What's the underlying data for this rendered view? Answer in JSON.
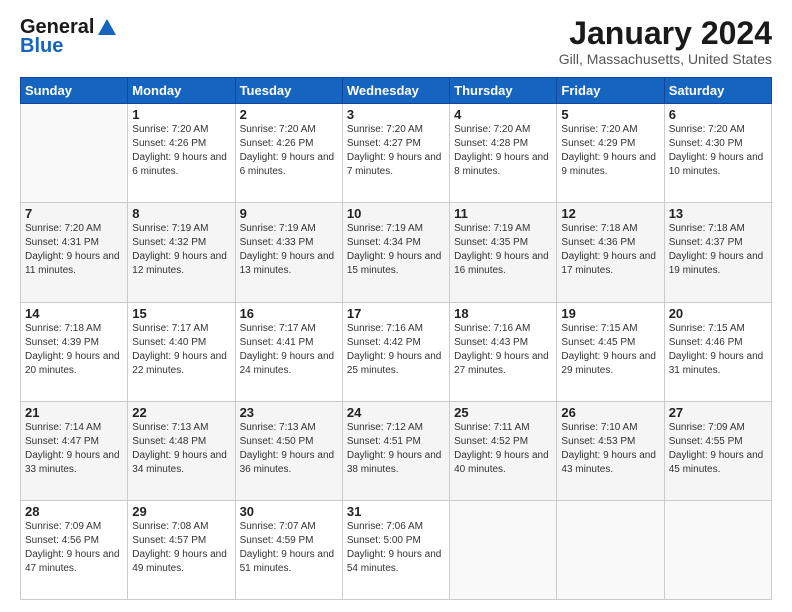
{
  "header": {
    "logo_line1": "General",
    "logo_line2": "Blue",
    "title": "January 2024",
    "subtitle": "Gill, Massachusetts, United States"
  },
  "weekdays": [
    "Sunday",
    "Monday",
    "Tuesday",
    "Wednesday",
    "Thursday",
    "Friday",
    "Saturday"
  ],
  "weeks": [
    [
      {
        "num": "",
        "sunrise": "",
        "sunset": "",
        "daylight": "",
        "empty": true
      },
      {
        "num": "1",
        "sunrise": "Sunrise: 7:20 AM",
        "sunset": "Sunset: 4:26 PM",
        "daylight": "Daylight: 9 hours and 6 minutes."
      },
      {
        "num": "2",
        "sunrise": "Sunrise: 7:20 AM",
        "sunset": "Sunset: 4:26 PM",
        "daylight": "Daylight: 9 hours and 6 minutes."
      },
      {
        "num": "3",
        "sunrise": "Sunrise: 7:20 AM",
        "sunset": "Sunset: 4:27 PM",
        "daylight": "Daylight: 9 hours and 7 minutes."
      },
      {
        "num": "4",
        "sunrise": "Sunrise: 7:20 AM",
        "sunset": "Sunset: 4:28 PM",
        "daylight": "Daylight: 9 hours and 8 minutes."
      },
      {
        "num": "5",
        "sunrise": "Sunrise: 7:20 AM",
        "sunset": "Sunset: 4:29 PM",
        "daylight": "Daylight: 9 hours and 9 minutes."
      },
      {
        "num": "6",
        "sunrise": "Sunrise: 7:20 AM",
        "sunset": "Sunset: 4:30 PM",
        "daylight": "Daylight: 9 hours and 10 minutes."
      }
    ],
    [
      {
        "num": "7",
        "sunrise": "Sunrise: 7:20 AM",
        "sunset": "Sunset: 4:31 PM",
        "daylight": "Daylight: 9 hours and 11 minutes."
      },
      {
        "num": "8",
        "sunrise": "Sunrise: 7:19 AM",
        "sunset": "Sunset: 4:32 PM",
        "daylight": "Daylight: 9 hours and 12 minutes."
      },
      {
        "num": "9",
        "sunrise": "Sunrise: 7:19 AM",
        "sunset": "Sunset: 4:33 PM",
        "daylight": "Daylight: 9 hours and 13 minutes."
      },
      {
        "num": "10",
        "sunrise": "Sunrise: 7:19 AM",
        "sunset": "Sunset: 4:34 PM",
        "daylight": "Daylight: 9 hours and 15 minutes."
      },
      {
        "num": "11",
        "sunrise": "Sunrise: 7:19 AM",
        "sunset": "Sunset: 4:35 PM",
        "daylight": "Daylight: 9 hours and 16 minutes."
      },
      {
        "num": "12",
        "sunrise": "Sunrise: 7:18 AM",
        "sunset": "Sunset: 4:36 PM",
        "daylight": "Daylight: 9 hours and 17 minutes."
      },
      {
        "num": "13",
        "sunrise": "Sunrise: 7:18 AM",
        "sunset": "Sunset: 4:37 PM",
        "daylight": "Daylight: 9 hours and 19 minutes."
      }
    ],
    [
      {
        "num": "14",
        "sunrise": "Sunrise: 7:18 AM",
        "sunset": "Sunset: 4:39 PM",
        "daylight": "Daylight: 9 hours and 20 minutes."
      },
      {
        "num": "15",
        "sunrise": "Sunrise: 7:17 AM",
        "sunset": "Sunset: 4:40 PM",
        "daylight": "Daylight: 9 hours and 22 minutes."
      },
      {
        "num": "16",
        "sunrise": "Sunrise: 7:17 AM",
        "sunset": "Sunset: 4:41 PM",
        "daylight": "Daylight: 9 hours and 24 minutes."
      },
      {
        "num": "17",
        "sunrise": "Sunrise: 7:16 AM",
        "sunset": "Sunset: 4:42 PM",
        "daylight": "Daylight: 9 hours and 25 minutes."
      },
      {
        "num": "18",
        "sunrise": "Sunrise: 7:16 AM",
        "sunset": "Sunset: 4:43 PM",
        "daylight": "Daylight: 9 hours and 27 minutes."
      },
      {
        "num": "19",
        "sunrise": "Sunrise: 7:15 AM",
        "sunset": "Sunset: 4:45 PM",
        "daylight": "Daylight: 9 hours and 29 minutes."
      },
      {
        "num": "20",
        "sunrise": "Sunrise: 7:15 AM",
        "sunset": "Sunset: 4:46 PM",
        "daylight": "Daylight: 9 hours and 31 minutes."
      }
    ],
    [
      {
        "num": "21",
        "sunrise": "Sunrise: 7:14 AM",
        "sunset": "Sunset: 4:47 PM",
        "daylight": "Daylight: 9 hours and 33 minutes."
      },
      {
        "num": "22",
        "sunrise": "Sunrise: 7:13 AM",
        "sunset": "Sunset: 4:48 PM",
        "daylight": "Daylight: 9 hours and 34 minutes."
      },
      {
        "num": "23",
        "sunrise": "Sunrise: 7:13 AM",
        "sunset": "Sunset: 4:50 PM",
        "daylight": "Daylight: 9 hours and 36 minutes."
      },
      {
        "num": "24",
        "sunrise": "Sunrise: 7:12 AM",
        "sunset": "Sunset: 4:51 PM",
        "daylight": "Daylight: 9 hours and 38 minutes."
      },
      {
        "num": "25",
        "sunrise": "Sunrise: 7:11 AM",
        "sunset": "Sunset: 4:52 PM",
        "daylight": "Daylight: 9 hours and 40 minutes."
      },
      {
        "num": "26",
        "sunrise": "Sunrise: 7:10 AM",
        "sunset": "Sunset: 4:53 PM",
        "daylight": "Daylight: 9 hours and 43 minutes."
      },
      {
        "num": "27",
        "sunrise": "Sunrise: 7:09 AM",
        "sunset": "Sunset: 4:55 PM",
        "daylight": "Daylight: 9 hours and 45 minutes."
      }
    ],
    [
      {
        "num": "28",
        "sunrise": "Sunrise: 7:09 AM",
        "sunset": "Sunset: 4:56 PM",
        "daylight": "Daylight: 9 hours and 47 minutes."
      },
      {
        "num": "29",
        "sunrise": "Sunrise: 7:08 AM",
        "sunset": "Sunset: 4:57 PM",
        "daylight": "Daylight: 9 hours and 49 minutes."
      },
      {
        "num": "30",
        "sunrise": "Sunrise: 7:07 AM",
        "sunset": "Sunset: 4:59 PM",
        "daylight": "Daylight: 9 hours and 51 minutes."
      },
      {
        "num": "31",
        "sunrise": "Sunrise: 7:06 AM",
        "sunset": "Sunset: 5:00 PM",
        "daylight": "Daylight: 9 hours and 54 minutes."
      },
      {
        "num": "",
        "sunrise": "",
        "sunset": "",
        "daylight": "",
        "empty": true
      },
      {
        "num": "",
        "sunrise": "",
        "sunset": "",
        "daylight": "",
        "empty": true
      },
      {
        "num": "",
        "sunrise": "",
        "sunset": "",
        "daylight": "",
        "empty": true
      }
    ]
  ]
}
